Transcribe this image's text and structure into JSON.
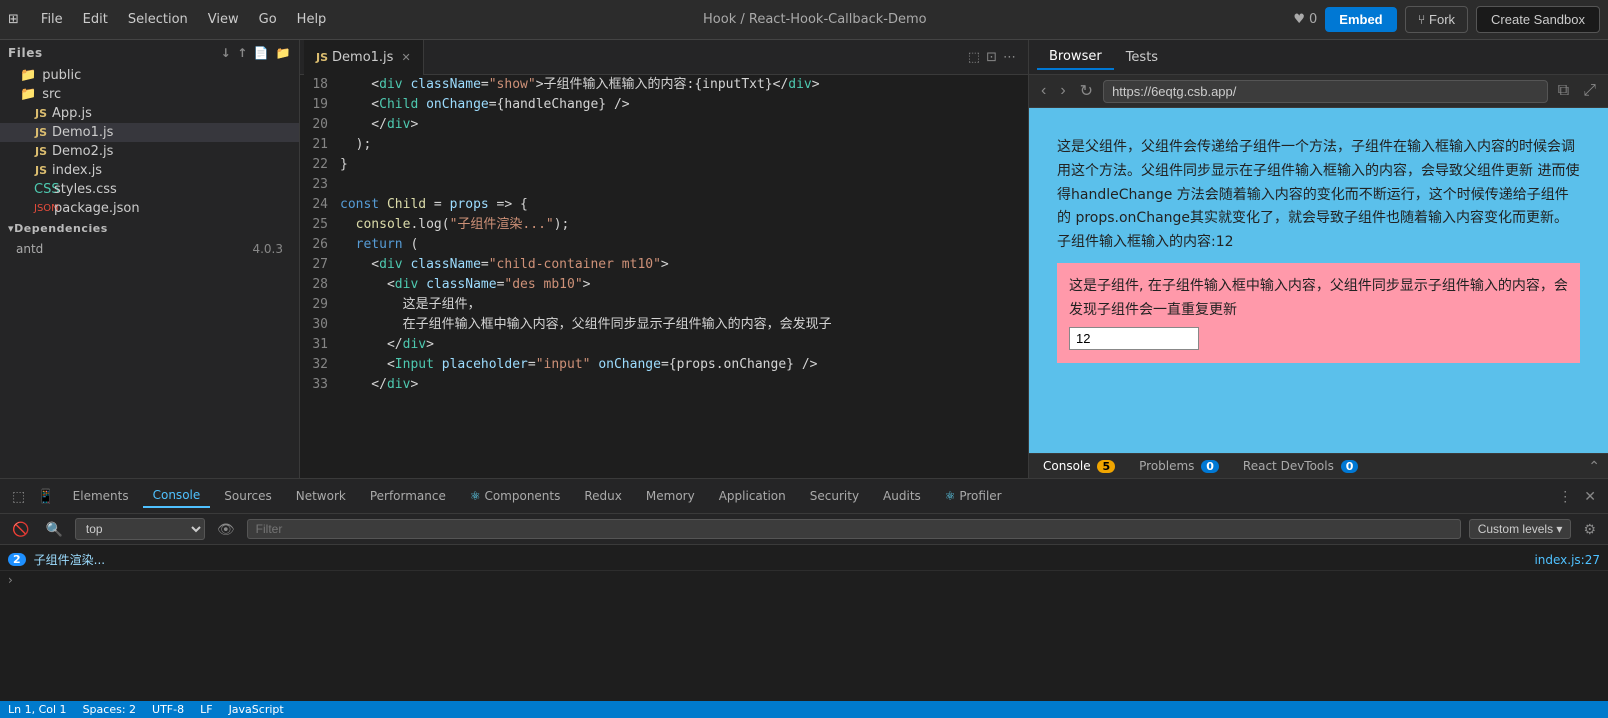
{
  "topMenu": {
    "gridIcon": "⊞",
    "menuItems": [
      "File",
      "Edit",
      "Selection",
      "View",
      "Go",
      "Help"
    ],
    "breadcrumb": "Hook / React-Hook-Callback-Demo",
    "starCount": "0",
    "embedLabel": "Embed",
    "forkLabel": "Fork",
    "sandboxLabel": "Create Sandbox"
  },
  "sidebar": {
    "filesLabel": "Files",
    "folders": [
      {
        "name": "public",
        "type": "folder",
        "indent": 1
      },
      {
        "name": "src",
        "type": "folder",
        "indent": 1
      },
      {
        "name": "App.js",
        "type": "js",
        "indent": 2
      },
      {
        "name": "Demo1.js",
        "type": "js",
        "indent": 2,
        "selected": true
      },
      {
        "name": "Demo2.js",
        "type": "js",
        "indent": 2
      },
      {
        "name": "index.js",
        "type": "js",
        "indent": 2
      },
      {
        "name": "styles.css",
        "type": "css",
        "indent": 2
      },
      {
        "name": "package.json",
        "type": "json",
        "indent": 2
      }
    ],
    "depsLabel": "Dependencies",
    "deps": [
      {
        "name": "antd",
        "version": "4.0.3"
      }
    ]
  },
  "editor": {
    "tabLabel": "Demo1.js",
    "lines": [
      {
        "num": 18,
        "code": "    <div className=\"show\">子组件输入框输入的内容:{inputTxt}</div>"
      },
      {
        "num": 19,
        "code": "    <Child onChange={handleChange} />"
      },
      {
        "num": 20,
        "code": "    </div>"
      },
      {
        "num": 21,
        "code": "  );"
      },
      {
        "num": 22,
        "code": "}"
      },
      {
        "num": 23,
        "code": ""
      },
      {
        "num": 24,
        "code": "const Child = props => {"
      },
      {
        "num": 25,
        "code": "  console.log(\"子组件渲染...\");"
      },
      {
        "num": 26,
        "code": "  return ("
      },
      {
        "num": 27,
        "code": "    <div className=\"child-container mt10\">"
      },
      {
        "num": 28,
        "code": "      <div className=\"des mb10\">"
      },
      {
        "num": 29,
        "code": "        这是子组件，"
      },
      {
        "num": 30,
        "code": "        在子组件输入框中输入内容，父组件同步显示子组件输入的内容，会发现子"
      },
      {
        "num": 31,
        "code": "      </div>"
      },
      {
        "num": 32,
        "code": "      <Input placeholder=\"input\" onChange={props.onChange} />"
      },
      {
        "num": 33,
        "code": "    </div>"
      }
    ]
  },
  "browser": {
    "browserTabLabel": "Browser",
    "testsTabLabel": "Tests",
    "urlValue": "https://6eqtg.csb.app/",
    "appPreview": {
      "parentText": "这是父组件，父组件会传递给子组件一个方法，子组件在输入框输入内容的时候会调用这个方法。父组件同步显示在子组件输入框输入的内容，会导致父组件更新 进而使得handleChange 方法会随着输入内容的变化而不断运行，这个时候传递给子组件的 props.onChange其实就变化了，就会导致子组件也随着输入内容变化而更新。",
      "parentInputTxt": "子组件输入框输入的内容:12",
      "childText": "这是子组件, 在子组件输入框中输入内容，父组件同步显示子组件输入的内容，会发现子组件会一直重复更新",
      "inputValue": "12"
    },
    "bottomTabs": {
      "consoleLabel": "Console",
      "consoleBadge": "5",
      "problemsLabel": "Problems",
      "problemsBadge": "0",
      "reactDevToolsLabel": "React DevTools",
      "reactDevToolsBadge": "0"
    }
  },
  "devtools": {
    "tabs": [
      {
        "label": "Elements",
        "active": false
      },
      {
        "label": "Console",
        "active": true
      },
      {
        "label": "Sources",
        "active": false
      },
      {
        "label": "Network",
        "active": false
      },
      {
        "label": "Performance",
        "active": false
      },
      {
        "label": "Components",
        "active": false,
        "hasIcon": true
      },
      {
        "label": "Redux",
        "active": false
      },
      {
        "label": "Memory",
        "active": false
      },
      {
        "label": "Application",
        "active": false
      },
      {
        "label": "Security",
        "active": false
      },
      {
        "label": "Audits",
        "active": false
      },
      {
        "label": "Profiler",
        "active": false,
        "hasIcon": true
      }
    ],
    "toolbar": {
      "topLabel": "top",
      "filterPlaceholder": "Filter",
      "customLevelsLabel": "Custom levels ▾"
    },
    "consoleRows": [
      {
        "badge": "2",
        "message": "子组件渲染...",
        "fileRef": "index.js:27"
      }
    ],
    "arrowRow": "›",
    "statusBar": {
      "lineCol": "Ln 1, Col 1",
      "spaces": "Spaces: 2",
      "encoding": "UTF-8",
      "lineEnding": "LF",
      "language": "JavaScript"
    }
  }
}
